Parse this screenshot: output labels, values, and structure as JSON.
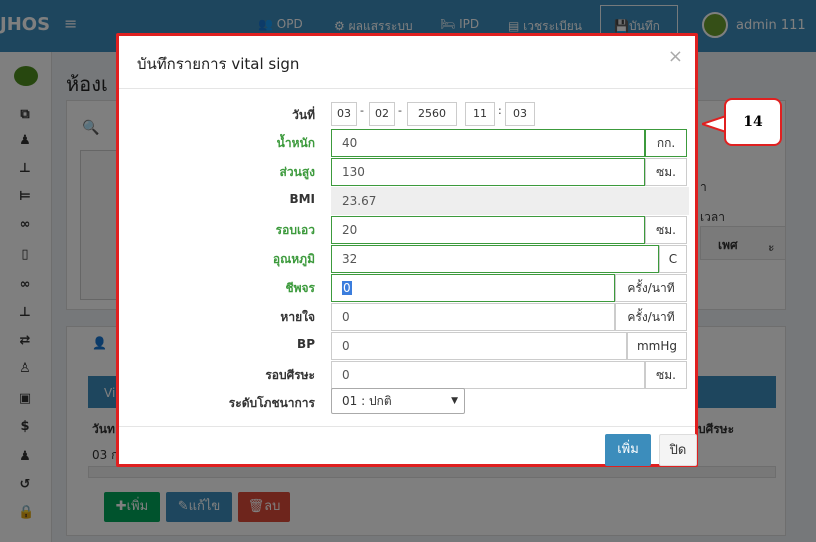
{
  "app": {
    "brand": "JHOS",
    "menu_icon": "menu-icon",
    "nav": [
      "OPD",
      "ผลแสรระบบ",
      "IPD",
      "เวชระเบียน",
      "บันทึก"
    ],
    "user": "admin 111"
  },
  "page": {
    "title": "ห้องเ",
    "search_icon": "search-icon",
    "fragments": [
      "า",
      "เวลา",
      "เพศ",
      "ะ"
    ],
    "table_header": "Vi",
    "col_first": "วันท",
    "col_last": "บศีรษะ",
    "row_value": "03 ก",
    "buttons": {
      "add": "เพิ่ม",
      "edit": "แก้ไข",
      "delete": "ลบ"
    }
  },
  "modal": {
    "title": "บันทึกรายการ vital sign",
    "close": "×",
    "date_label": "วันที่",
    "date": {
      "day": "03",
      "month": "02",
      "year": "2560",
      "hour": "11",
      "minute": "03"
    },
    "fields": [
      {
        "label": "น้ำหนัก",
        "value": "40",
        "unit": "กก.",
        "state": "ok"
      },
      {
        "label": "ส่วนสูง",
        "value": "130",
        "unit": "ซม.",
        "state": "ok"
      },
      {
        "label": "BMI",
        "value": "23.67",
        "unit": "",
        "state": "readonly"
      },
      {
        "label": "รอบเอว",
        "value": "20",
        "unit": "ซม.",
        "state": "ok"
      },
      {
        "label": "อุณหภูมิ",
        "value": "32",
        "unit": "C",
        "state": "ok"
      },
      {
        "label": "ชีพจร",
        "value": "0",
        "unit": "ครั้ง/นาที",
        "state": "ok"
      },
      {
        "label": "หายใจ",
        "value": "0",
        "unit": "ครั้ง/นาที",
        "state": "normal"
      },
      {
        "label": "BP",
        "value": "0",
        "unit": "mmHg",
        "state": "normal"
      },
      {
        "label": "รอบศีรษะ",
        "value": "0",
        "unit": "ซม.",
        "state": "normal"
      }
    ],
    "nutrition_label": "ระดับโภชนาการ",
    "nutrition_value": "01 : ปกติ",
    "save_button": "เพิ่ม",
    "close_button": "ปิด"
  },
  "annotation": {
    "label": "14",
    "color": "#e02020"
  },
  "colors": {
    "primary": "#3c8dbc",
    "success": "#3c9a3c",
    "danger": "#dd4b39",
    "warning": "#f39c12",
    "accent_red": "#e02020"
  }
}
